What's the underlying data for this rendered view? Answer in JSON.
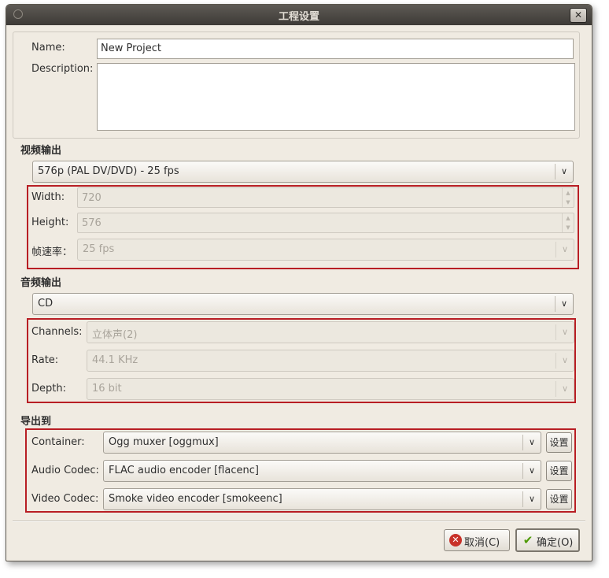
{
  "window": {
    "title": "工程设置",
    "close_glyph": "✕"
  },
  "project": {
    "name_label": "Name:",
    "name_value": "New Project",
    "description_label": "Description:",
    "description_value": ""
  },
  "video": {
    "section_title": "视频输出",
    "preset": "576p (PAL DV/DVD) - 25 fps",
    "width_label": "Width:",
    "width_value": "720",
    "height_label": "Height:",
    "height_value": "576",
    "framerate_label": "帧速率：",
    "framerate_value": "25 fps"
  },
  "audio": {
    "section_title": "音频输出",
    "preset": "CD",
    "channels_label": "Channels:",
    "channels_value": "立体声(2)",
    "rate_label": "Rate:",
    "rate_value": "44.1 KHz",
    "depth_label": "Depth:",
    "depth_value": "16 bit"
  },
  "export": {
    "section_title": "导出到",
    "container_label": "Container:",
    "container_value": "Ogg muxer [oggmux]",
    "audio_codec_label": "Audio Codec:",
    "audio_codec_value": "FLAC audio encoder [flacenc]",
    "video_codec_label": "Video Codec:",
    "video_codec_value": "Smoke video encoder [smokeenc]",
    "settings_label": "设置"
  },
  "buttons": {
    "cancel_label": "取消(C)",
    "ok_label": "确定(O)"
  },
  "icons": {
    "dropdown": "chevron-down-icon",
    "cancel": "cancel-icon",
    "ok": "check-icon"
  },
  "colors": {
    "highlight": "#b81e24",
    "cancel_icon": "#c8322a",
    "ok_icon": "#4e9a06"
  }
}
